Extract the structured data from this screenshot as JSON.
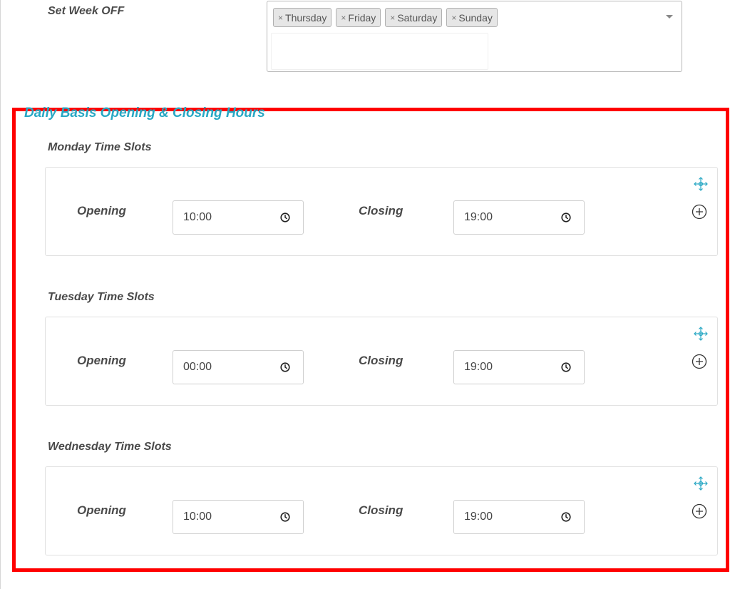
{
  "week_off": {
    "label": "Set Week OFF",
    "selected_days": [
      "Thursday",
      "Friday",
      "Saturday",
      "Sunday"
    ],
    "remove_glyph": "×"
  },
  "section": {
    "title": "Daily Basis Opening & Closing Hours"
  },
  "days": [
    {
      "label": "Monday Time Slots",
      "opening_label": "Opening",
      "opening": "10:00",
      "closing_label": "Closing",
      "closing": "19:00"
    },
    {
      "label": "Tuesday Time Slots",
      "opening_label": "Opening",
      "opening": "00:00",
      "closing_label": "Closing",
      "closing": "19:00"
    },
    {
      "label": "Wednesday Time Slots",
      "opening_label": "Opening",
      "opening": "10:00",
      "closing_label": "Closing",
      "closing": "19:00"
    }
  ],
  "colors": {
    "accent": "#29a8c4",
    "highlight_frame": "#ff0000"
  },
  "icons": {
    "clock": "clock-icon",
    "move": "move-arrows-icon",
    "add": "plus-circle-icon",
    "dropdown": "chevron-down-icon"
  }
}
